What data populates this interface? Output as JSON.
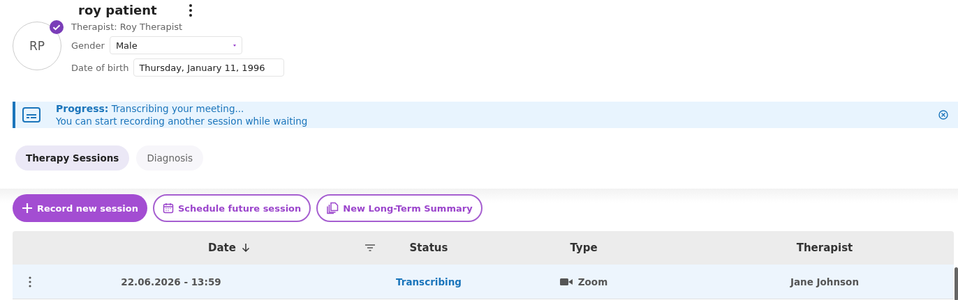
{
  "patient": {
    "name": "roy patient",
    "initials": "RP",
    "verified": true,
    "therapist": "Therapist: Roy Therapist",
    "gender_label": "Gender",
    "gender": "Male",
    "dob_label": "Date of birth",
    "dob": "Thursday, January 11, 1996"
  },
  "banner": {
    "title": "Progress:",
    "message": "Transcribing your meeting...",
    "detail": "You can start recording another session while waiting"
  },
  "tabs": [
    {
      "label": "Therapy Sessions",
      "selected": true
    },
    {
      "label": "Diagnosis",
      "selected": false
    }
  ],
  "actions": [
    {
      "label": "Record new session",
      "kind": "primary"
    },
    {
      "label": "Schedule future session",
      "kind": "calendar"
    },
    {
      "label": "New Long-Term Summary",
      "kind": "copy"
    }
  ],
  "table": {
    "columns": [
      "Date",
      "Status",
      "Type",
      "Therapist"
    ],
    "rows": [
      {
        "date": "22.06.2026 - 13:59",
        "status": "Transcribing",
        "type": "Zoom",
        "therapist": "Jane Johnson",
        "selected": true
      }
    ]
  }
}
